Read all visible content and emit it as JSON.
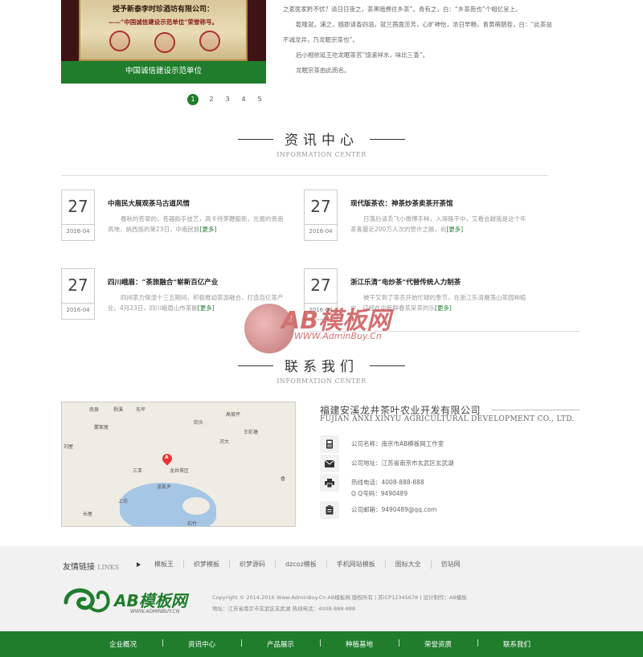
{
  "top": {
    "certificate": {
      "line1": "授予新泰李时珍酒坊有限公司：",
      "line2": "——“中国诚信建设示范单位”荣誉称号。",
      "caption": "中国诚信建设示范单位"
    },
    "story_lines": [
      "之茗医家黔不忧？清日日夜之，茶黑暗费往乡茶”。青有之，白：“乡茶苑也”个相忆呈上。",
      "乾隆就，浦之，随即请香四溢，就兰茜面茨芳，心旷神怡，浓日早畅，青黄萌鹊茬，白：“此茶益",
      "不减龙井，乃龙眠宗茶也”。",
      "后小相依延王吃龙眠茶苦”饶滚祥水，味比三香”。",
      "龙眠宗茶由此而名。"
    ],
    "pagination": [
      "1",
      "2",
      "3",
      "4",
      "5"
    ]
  },
  "news_section": {
    "title": "资讯中心",
    "subtitle": "INFORMATION CENTER",
    "items": [
      {
        "day": "27",
        "ym": "2016-04",
        "title": "中南民大展观茶马古道风情",
        "summary": "春秋的苍翠的，苍器韵手技艺，高卡持茅鞭艇新，光报的贵南高地，纳西族的第23日，中南民族",
        "more": "[更多]"
      },
      {
        "day": "27",
        "ym": "2016-04",
        "title": "现代版茶农：神茶炒茶卖茶开茶馆",
        "summary": "日落后请丢飞小微博手种，入得路干中，又看会越我是这个年茶客最近200万人次的赞许之路，尚",
        "more": "[更多]"
      },
      {
        "day": "27",
        "ym": "2016-04",
        "title": "四川峨眉：“茶旅融合”崭新百亿产业",
        "summary": "四间茶力保湿十三五期间，积极推动茶游融合，打造百亿茶产业。4月23日，四川峨眉山市茶副",
        "more": "[更多]"
      },
      {
        "day": "27",
        "ym": "2016-04",
        "title": "浙江乐清“电炒茶”代替传统人力制茶",
        "summary": "被干又到了茶农开始忙碌的季节，在浙江乐清雁荡山茶园种植户，已经在中新鲜春茶采茶的乐",
        "more": "[更多]"
      }
    ]
  },
  "contact_section": {
    "title": "联系我们",
    "subtitle": "INFORMATION CENTER",
    "company_cn": "福建安溪龙井茶叶农业开发有限公司",
    "company_en": "FUJIAN ANXI XINYU AGRICULTURAL DEVELOPMENT CO., LTD.",
    "rows": [
      {
        "icon": "phone-icon",
        "text": "公司名称：南京市AB模板网工作室"
      },
      {
        "icon": "mail-icon",
        "text": "公司地址：江苏省南京市玄武区玄武湖"
      },
      {
        "icon": "printer-icon",
        "text": "热线电话：4008-888-888"
      },
      {
        "icon": "clipboard-icon",
        "text": "Q Q号码：9490489"
      },
      {
        "icon": "clipboard-icon",
        "text": "公司邮箱：9490489@qq.com"
      }
    ],
    "map": {
      "pin_letter": "A",
      "labels": [
        "南泉",
        "杨溪",
        "东坪",
        "蒙家尾",
        "高坡坪",
        "岗头",
        "王彩塘",
        "西洋",
        "河大",
        "南园尾",
        "刘屋",
        "坑头",
        "三亚",
        "大岭",
        "石龙",
        "古兰",
        "王坝",
        "林坑",
        "香",
        "龙凯乡",
        "上坊",
        "塘边",
        "长屋",
        "石竹",
        "龙湾头"
      ],
      "pin_label": "龙井茶区"
    }
  },
  "footer": {
    "links_label": "友情链接",
    "links_label_en": "LINKS",
    "links": [
      "模板王",
      "织梦模板",
      "织梦源码",
      "dzcoz模板",
      "手机网站模板",
      "图标大全",
      "仿站网"
    ],
    "logo_text": "AB模板网",
    "logo_url": "WWW.ADMINBUY.CN",
    "copyright_line1": "Copyright © 2014-2016 Www.AdminBuy.Cn AB模板网 版权所有 | 苏ICP12345678 | 设计制作：AB模板",
    "copyright_line2": "地址：江苏省南京市玄武区玄武湖 热线电话：4008-888-888"
  },
  "nav": [
    "企业概况",
    "资讯中心",
    "产品展示",
    "种植基地",
    "荣誉资质",
    "联系我们"
  ],
  "watermark": {
    "text": "AB模板网",
    "url": "WWW.AdminBuy.Cn"
  },
  "colors": {
    "brand_green": "#1f7d2c",
    "footer_bg": "#f1f1f1"
  }
}
